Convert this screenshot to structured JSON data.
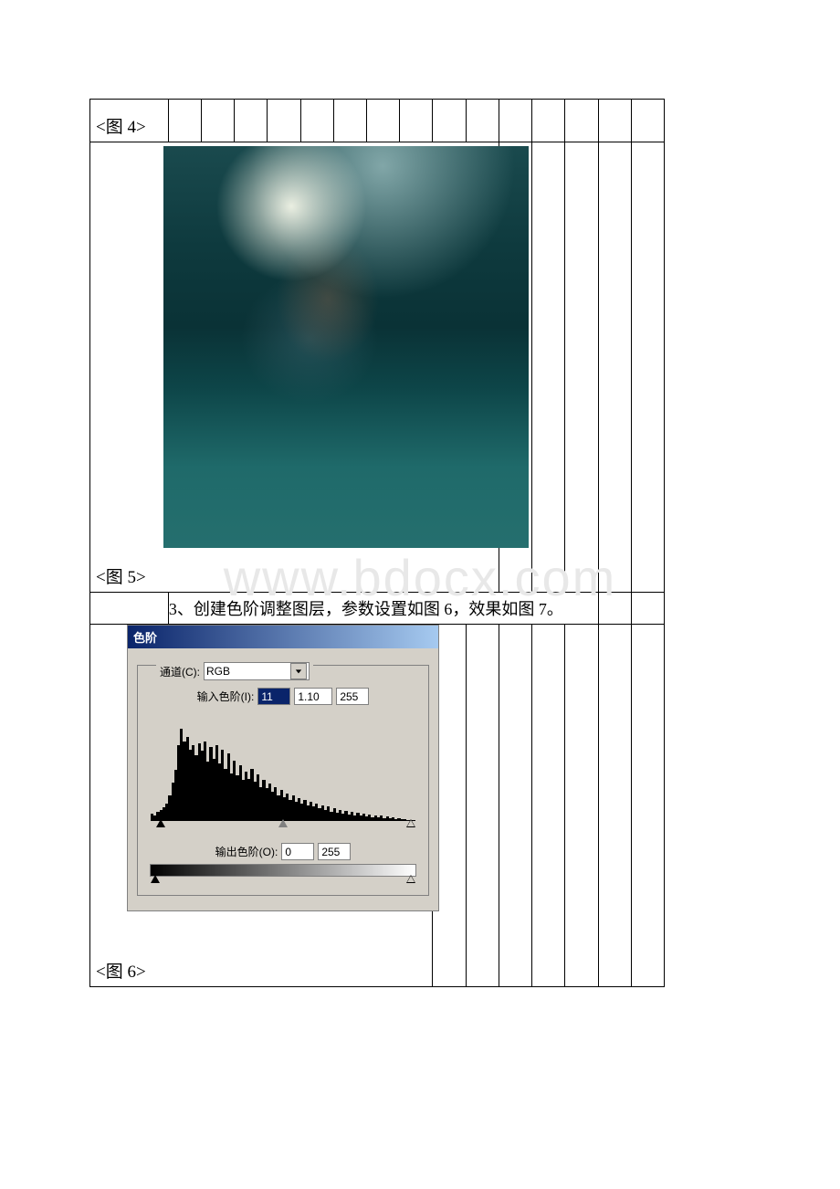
{
  "watermark": "www.bdocx.com",
  "figure4_label": "<图 4>",
  "figure5_label": "<图 5>",
  "figure6_label": "<图 6>",
  "step_text": "3、创建色阶调整图层，参数设置如图 6，效果如图 7。",
  "levels_dialog": {
    "title": "色阶",
    "channel_label": "通道(C):",
    "channel_value": "RGB",
    "input_label": "输入色阶(I):",
    "input_black": "11",
    "input_gamma": "1.10",
    "input_white": "255",
    "output_label": "输出色阶(O):",
    "output_black": "0",
    "output_white": "255"
  }
}
